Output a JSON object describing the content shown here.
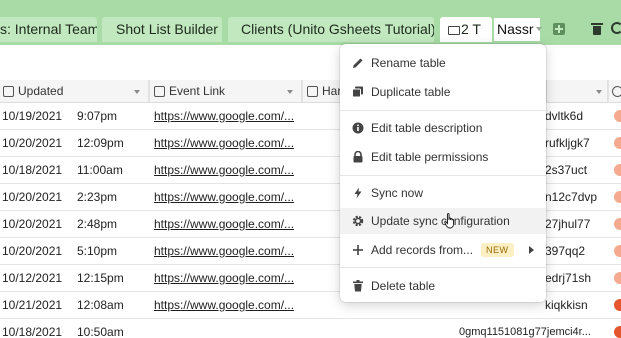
{
  "tabs": [
    {
      "label": "s: Internal Team"
    },
    {
      "label": "Shot List Builder"
    },
    {
      "label": "Clients (Unito Gsheets Tutorial)"
    },
    {
      "label": "2 T"
    }
  ],
  "rename_input": {
    "value": "Nassr"
  },
  "columns": [
    {
      "label": "Updated",
      "icon": "calendar-edit-icon"
    },
    {
      "label": "Event Link",
      "icon": "link-sync-icon"
    },
    {
      "label": "Har",
      "icon": "sync-icon"
    }
  ],
  "rows": [
    {
      "date": "10/19/2021",
      "time": "9:07pm",
      "link": "https://www.google.com/...",
      "id_end": "dvltk6d"
    },
    {
      "date": "10/20/2021",
      "time": "12:09pm",
      "link": "https://www.google.com/...",
      "id_end": "rufkljgk7"
    },
    {
      "date": "10/18/2021",
      "time": "11:00am",
      "link": "https://www.google.com/...",
      "id_end": "2s37uct"
    },
    {
      "date": "10/20/2021",
      "time": "2:23pm",
      "link": "https://www.google.com/...",
      "id_end": "n12c7dvp"
    },
    {
      "date": "10/20/2021",
      "time": "2:48pm",
      "link": "https://www.google.com/...",
      "id_end": "27jhul77"
    },
    {
      "date": "10/20/2021",
      "time": "5:10pm",
      "link": "https://www.google.com/...",
      "id_end": "397qq2"
    },
    {
      "date": "10/12/2021",
      "time": "12:15pm",
      "link": "https://www.google.com/...",
      "id_end": "edrj71sh"
    },
    {
      "date": "10/21/2021",
      "time": "12:08am",
      "link": "https://www.google.com/...",
      "id_end": "kiqkkisn"
    },
    {
      "date": "10/18/2021",
      "time": "10:50am",
      "link": "https://www.google.com/...",
      "id_end": "0gmq1151081g77jemci4r..."
    }
  ],
  "menu": {
    "rename": "Rename table",
    "duplicate": "Duplicate table",
    "edit_description": "Edit table description",
    "edit_permissions": "Edit table permissions",
    "sync_now": "Sync now",
    "update_sync": "Update sync configuration",
    "add_records": "Add records from...",
    "new_badge": "NEW",
    "delete": "Delete table"
  },
  "colors": {
    "tabbar": "#a8dba5",
    "tab": "#c2e8bf",
    "badge_bg": "#fcefc4",
    "dot": "#f5a98e"
  }
}
